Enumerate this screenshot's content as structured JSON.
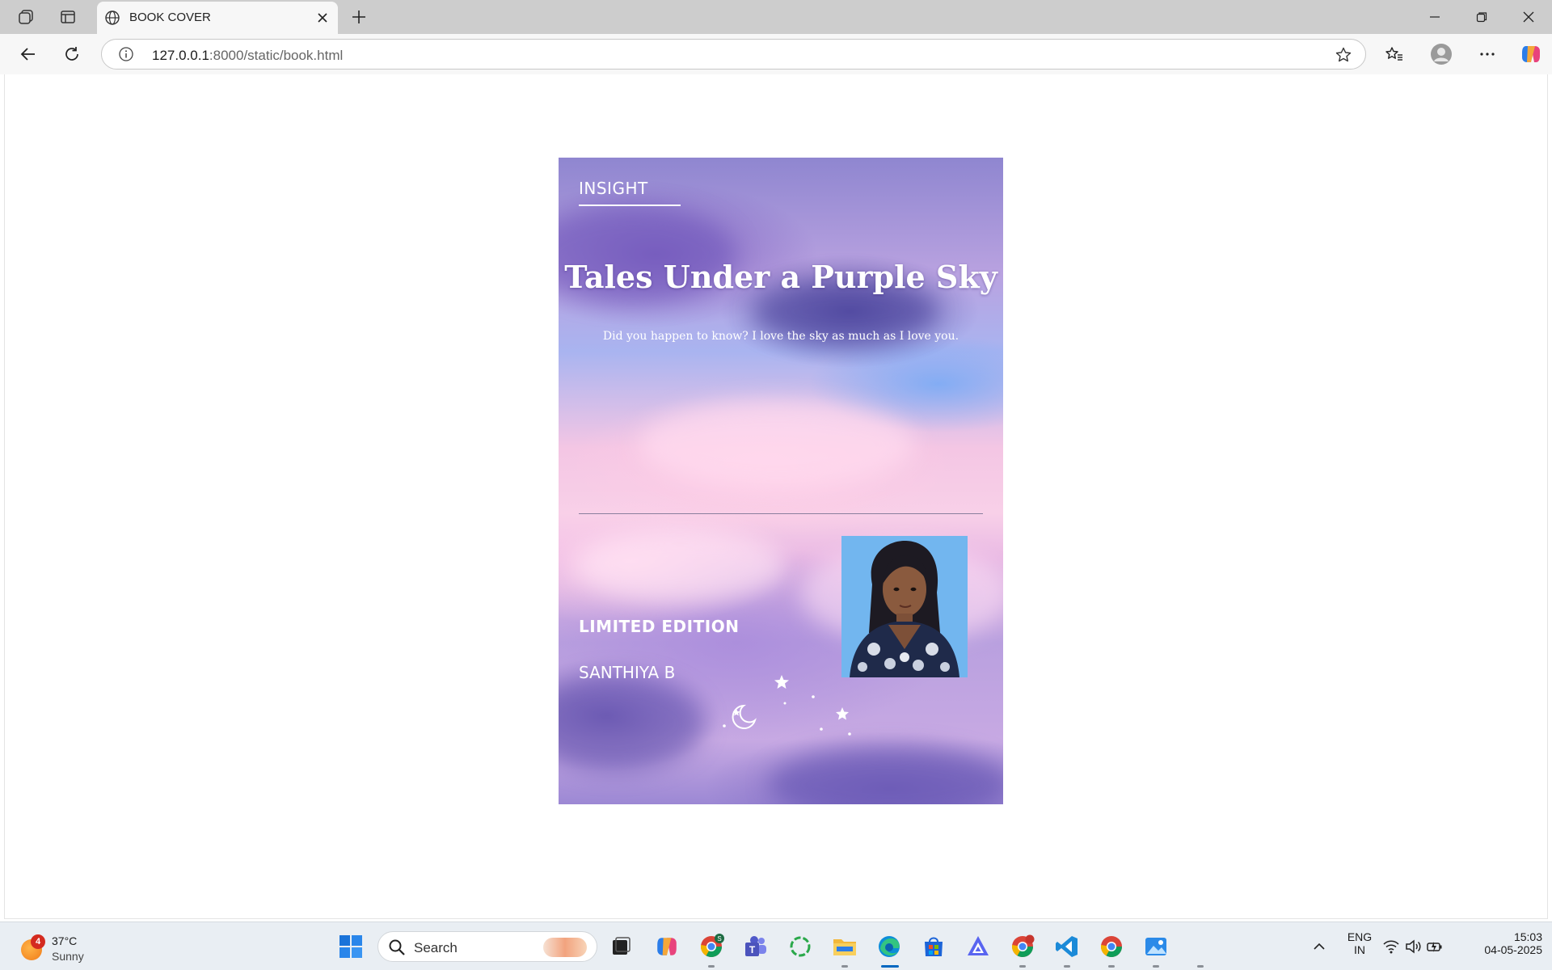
{
  "browser": {
    "tab_title": "BOOK COVER",
    "url_host": "127.0.0.1",
    "url_rest": ":8000/static/book.html"
  },
  "cover": {
    "brand": "INSIGHT",
    "title": "Tales Under a Purple Sky",
    "tagline": "Did you happen to know? I love the sky as much as I love you.",
    "edition": "LIMITED EDITION",
    "author": "SANTHIYA B"
  },
  "taskbar": {
    "weather_badge": "4",
    "weather_temp": "37°C",
    "weather_condition": "Sunny",
    "search_label": "Search",
    "lang_top": "ENG",
    "lang_bottom": "IN",
    "time": "15:03",
    "date": "04-05-2025"
  },
  "colors": {
    "accent_purple": "#9c88d4",
    "edge_blue": "#0067c0"
  }
}
